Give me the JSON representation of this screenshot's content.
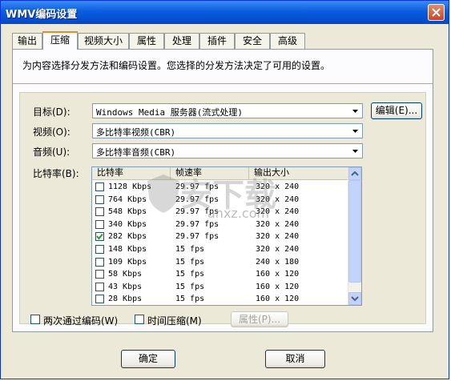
{
  "window": {
    "title": "WMV编码设置"
  },
  "tabs": [
    "输出",
    "压缩",
    "视频大小",
    "属性",
    "处理",
    "插件",
    "安全",
    "高级"
  ],
  "active_tab": "压缩",
  "description": "为内容选择分发方法和编码设置。您选择的分发方法决定了可用的设置。",
  "form": {
    "target_label": "目标(D):",
    "target_value": "Windows Media 服务器(流式处理)",
    "edit_button": "编辑(E)...",
    "video_label": "视频(O):",
    "video_value": "多比特率视频(CBR)",
    "audio_label": "音频(U):",
    "audio_value": "多比特率音频(CBR)",
    "bitrate_label": "比特率(B):"
  },
  "bitrate_table": {
    "columns": [
      "比特率",
      "帧速率",
      "输出大小"
    ],
    "rows": [
      {
        "bitrate": "1128 Kbps",
        "fps": "29.97 fps",
        "size": "320 x 240",
        "checked": false
      },
      {
        "bitrate": "764 Kbps",
        "fps": "29.97 fps",
        "size": "320 x 240",
        "checked": false
      },
      {
        "bitrate": "548 Kbps",
        "fps": "29.97 fps",
        "size": "320 x 240",
        "checked": false
      },
      {
        "bitrate": "340 Kbps",
        "fps": "29.97 fps",
        "size": "320 x 240",
        "checked": false
      },
      {
        "bitrate": "282 Kbps",
        "fps": "29.97 fps",
        "size": "320 x 240",
        "checked": true
      },
      {
        "bitrate": "148 Kbps",
        "fps": "15 fps",
        "size": "320 x 240",
        "checked": false
      },
      {
        "bitrate": "109 Kbps",
        "fps": "15 fps",
        "size": "240 x 180",
        "checked": false
      },
      {
        "bitrate": "58 Kbps",
        "fps": "15 fps",
        "size": "160 x 120",
        "checked": false
      },
      {
        "bitrate": "43 Kbps",
        "fps": "15 fps",
        "size": "160 x 120",
        "checked": false
      },
      {
        "bitrate": "28 Kbps",
        "fps": "15 fps",
        "size": "160 x 120",
        "checked": false
      }
    ]
  },
  "options": {
    "two_pass_label": "两次通过编码(W)",
    "time_compress_label": "时间压缩(M)",
    "properties_button": "属性(P)..."
  },
  "footer": {
    "ok": "确定",
    "cancel": "取消"
  },
  "watermark": {
    "cn": "安下载",
    "url": "anxz.com"
  },
  "colors": {
    "titlebar": "#0a5de0",
    "close": "#c8452a",
    "active_tab": "#e68b2c",
    "selected_check": "#21a121"
  }
}
